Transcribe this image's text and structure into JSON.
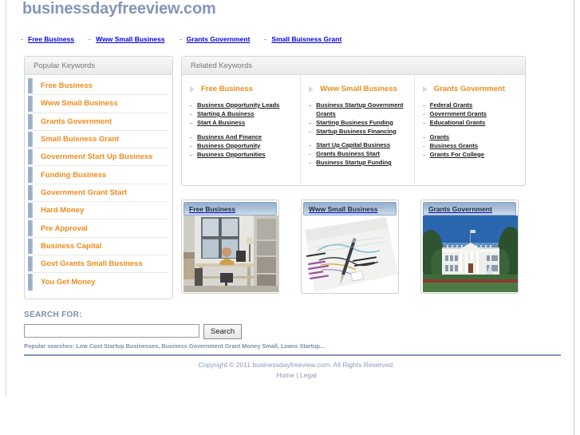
{
  "site": {
    "title": "businessdayfreeview.com"
  },
  "topnav": {
    "items": [
      "Free Business",
      "Www Small Business",
      "Grants Government",
      "Small Buisness Grant"
    ]
  },
  "sidebar": {
    "header": "Popular Keywords",
    "items": [
      "Free Business",
      "Www Small Business",
      "Grants Government",
      "Small Buisness Grant",
      "Government Start Up Business",
      "Funding Business",
      "Government Grant Start",
      "Hard Money",
      "Pre Approval",
      "Business Capital",
      "Govt Grants Small Business",
      "You Get Money"
    ]
  },
  "related": {
    "header": "Related Keywords",
    "columns": [
      {
        "title": "Free Business",
        "groups": [
          [
            "Business Opportunity Leads",
            "Starting A Business",
            "Start A Business"
          ],
          [
            "Business And Finance",
            "Business Opportunity",
            "Business Opportunities"
          ]
        ]
      },
      {
        "title": "Www Small Business",
        "groups": [
          [
            "Business Startup Government Grants",
            "Starting Business Funding",
            "Startup Business Financing"
          ],
          [
            "Start Up Capital Business",
            "Grants Business Start",
            "Business Startup Funding"
          ]
        ]
      },
      {
        "title": "Grants Government",
        "groups": [
          [
            "Federal Grants",
            "Government Grants",
            "Educational Grants"
          ],
          [
            "Grants",
            "Business Grants",
            "Grants For College"
          ]
        ]
      }
    ]
  },
  "cards": [
    {
      "title": "Free Business",
      "image": "office-desk-photo"
    },
    {
      "title": "Www Small Business",
      "image": "charts-document-pen-photo"
    },
    {
      "title": "Grants Government",
      "image": "white-house-photo"
    }
  ],
  "search": {
    "label": "SEARCH FOR:",
    "value": "",
    "placeholder": "",
    "button": "Search",
    "popular": "Popular searches: Low Cost Startup Businesses, Business Government Grant Money Small, Loans Startup..."
  },
  "footer": {
    "copyright": "Copyright © 2011 businessdayfreeview.com. All Rights Reserved.",
    "home": "Home",
    "separator": "|",
    "legal": "Legal"
  },
  "colors": {
    "brand_blue": "#8595b8",
    "link_orange": "#f08a1a",
    "card_header_blue": "#a9c0d9",
    "sidebar_bar": "#8ea5c5"
  }
}
